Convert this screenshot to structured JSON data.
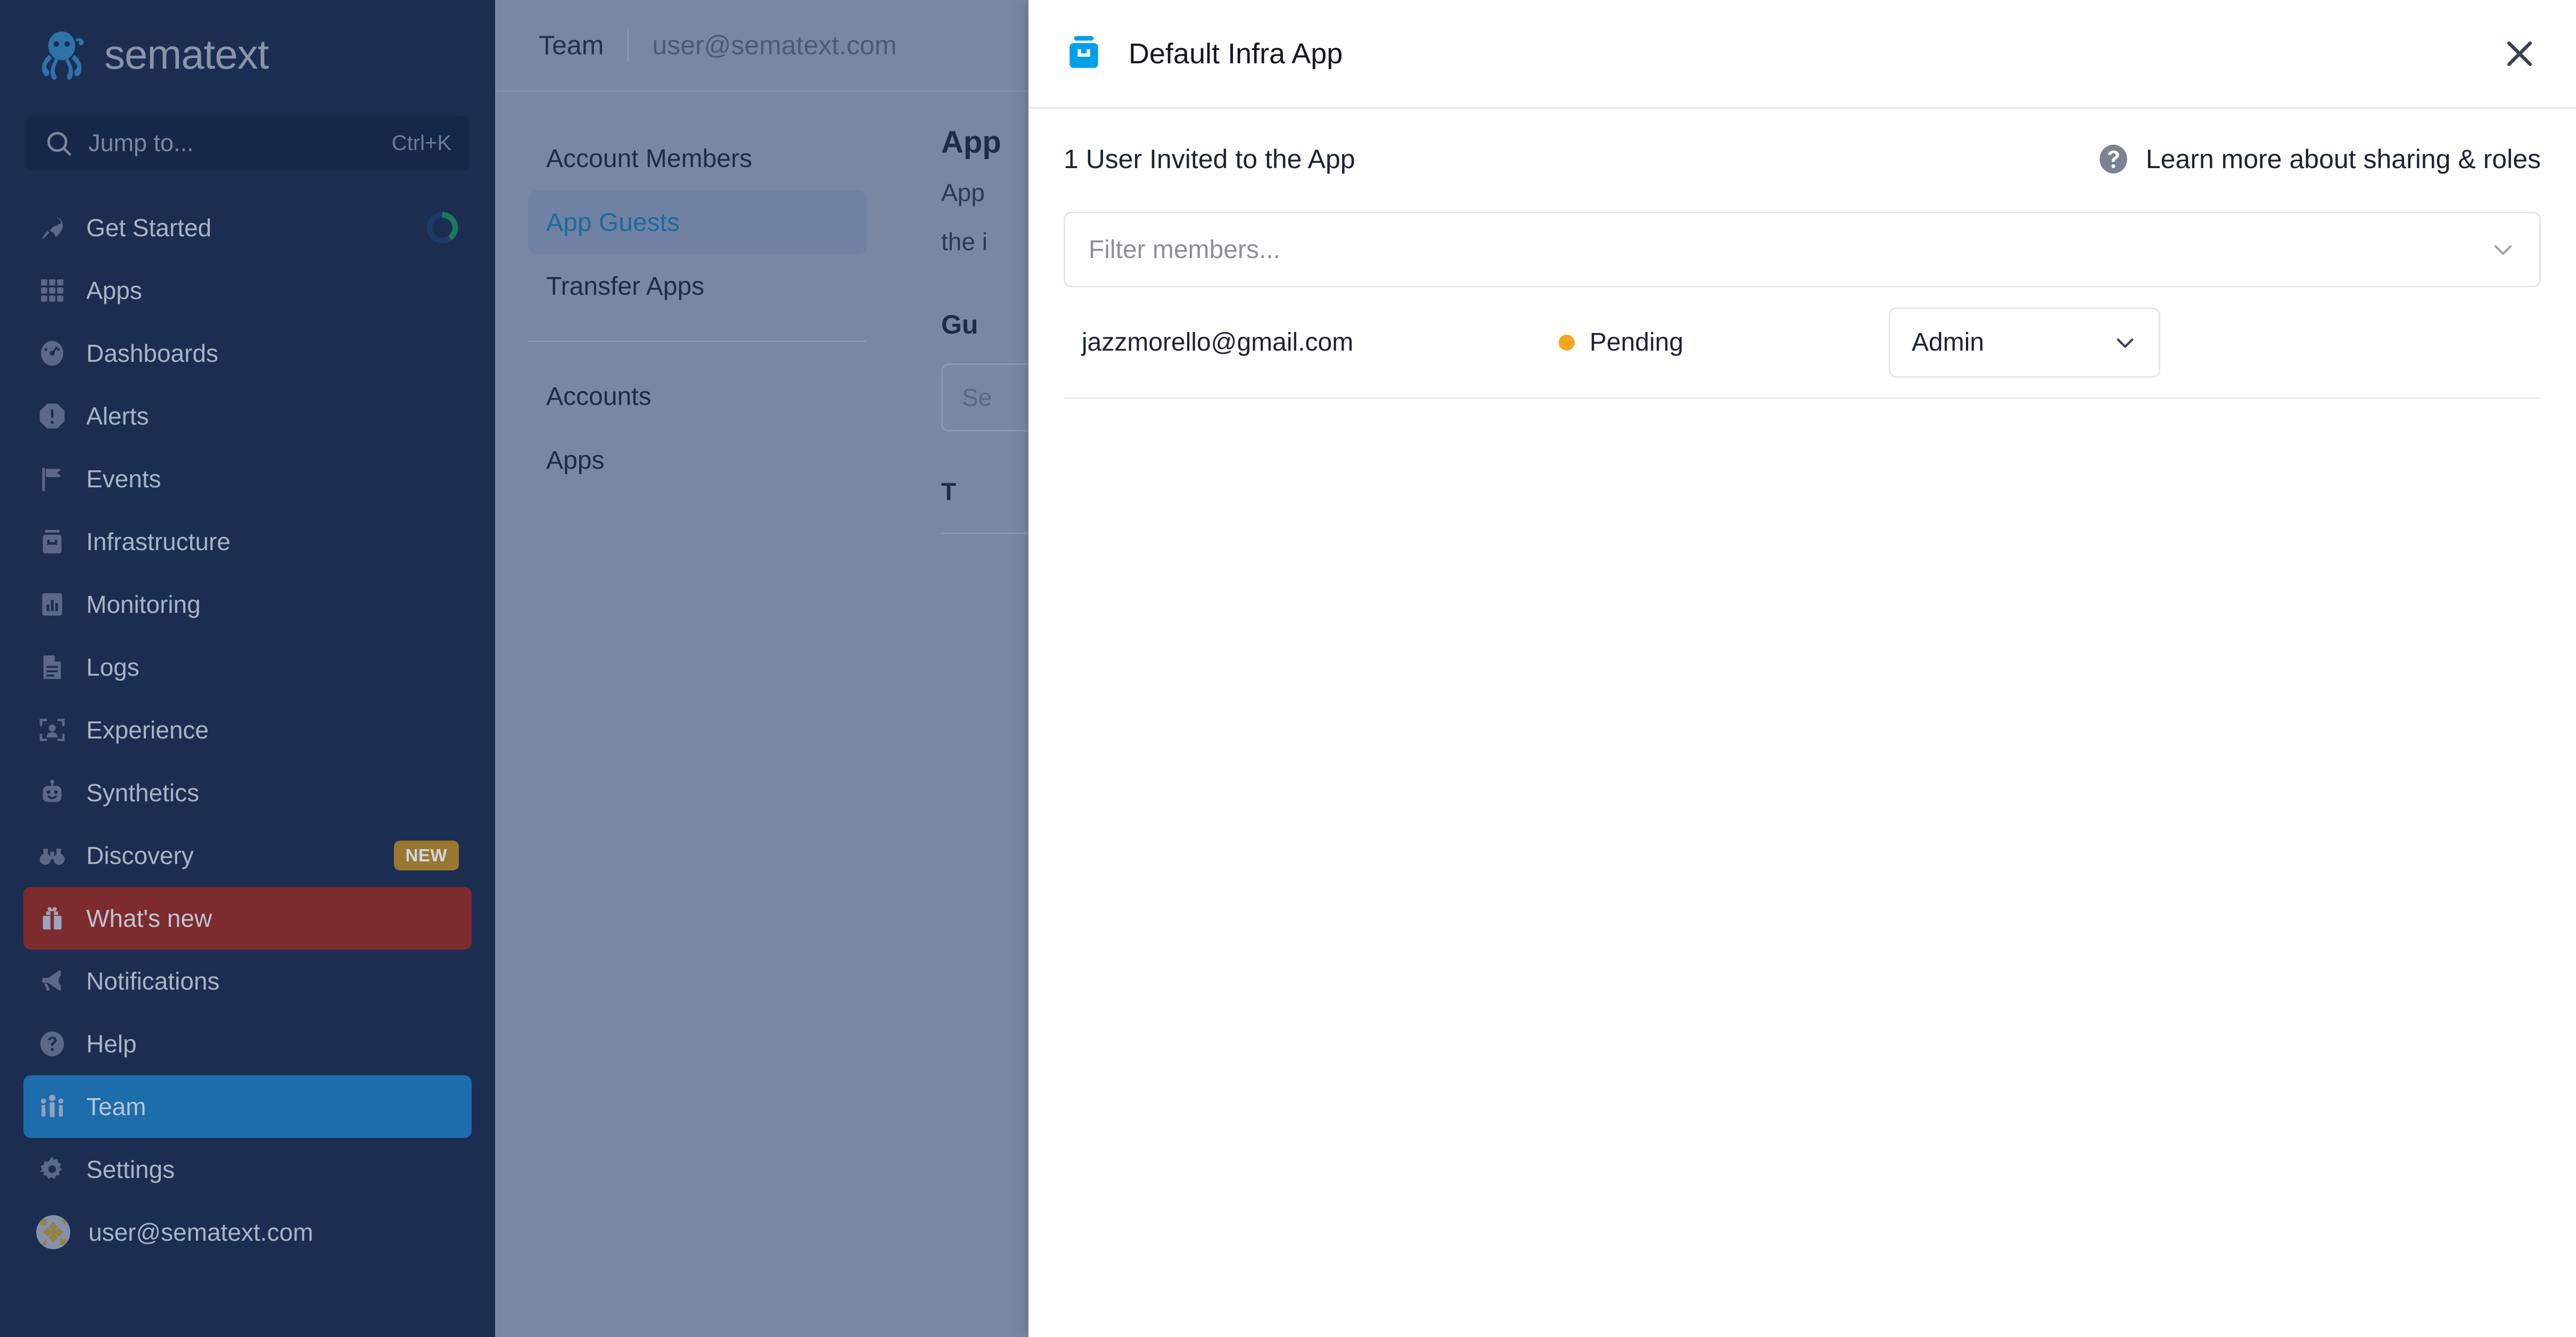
{
  "sidebar": {
    "brand": "sematext",
    "search": {
      "placeholder": "Jump to...",
      "shortcut": "Ctrl+K",
      "icon": "search-icon"
    },
    "items": [
      {
        "label": "Get Started",
        "icon": "rocket-icon",
        "state": "default",
        "ring": true
      },
      {
        "label": "Apps",
        "icon": "grid-icon",
        "state": "default"
      },
      {
        "label": "Dashboards",
        "icon": "gauge-icon",
        "state": "default"
      },
      {
        "label": "Alerts",
        "icon": "alert-octagon-icon",
        "state": "default"
      },
      {
        "label": "Events",
        "icon": "flag-icon",
        "state": "default"
      },
      {
        "label": "Infrastructure",
        "icon": "server-icon",
        "state": "default"
      },
      {
        "label": "Monitoring",
        "icon": "bar-chart-icon",
        "state": "default"
      },
      {
        "label": "Logs",
        "icon": "document-icon",
        "state": "default"
      },
      {
        "label": "Experience",
        "icon": "user-scan-icon",
        "state": "default"
      },
      {
        "label": "Synthetics",
        "icon": "robot-icon",
        "state": "default"
      },
      {
        "label": "Discovery",
        "icon": "binoculars-icon",
        "state": "default",
        "badge": "NEW"
      },
      {
        "label": "What's new",
        "icon": "gift-icon",
        "state": "active-red"
      },
      {
        "label": "Notifications",
        "icon": "megaphone-icon",
        "state": "default"
      },
      {
        "label": "Help",
        "icon": "question-circle-icon",
        "state": "default"
      },
      {
        "label": "Team",
        "icon": "team-icon",
        "state": "active-blue"
      },
      {
        "label": "Settings",
        "icon": "gear-icon",
        "state": "default"
      }
    ],
    "account": {
      "email": "user@sematext.com",
      "icon": "avatar"
    }
  },
  "page": {
    "breadcrumb": {
      "main": "Team",
      "sub": "user@sematext.com"
    },
    "subnav": {
      "group1": [
        "Account Members",
        "App Guests",
        "Transfer Apps"
      ],
      "group2": [
        "Accounts",
        "Apps"
      ],
      "active": "App Guests"
    },
    "main": {
      "title": "App",
      "desc_line1": "App",
      "desc_line2": "the i",
      "section": "Gu",
      "search_placeholder": "Se",
      "table_header": "T"
    }
  },
  "modal": {
    "title": "Default Infra App",
    "app_icon": "inbox-icon",
    "close_icon": "close-icon",
    "invited_count": "1 User Invited to the App",
    "learn_more": "Learn more about sharing & roles",
    "learn_more_icon": "question-circle-icon",
    "filter": {
      "placeholder": "Filter members...",
      "caret_icon": "chevron-down-icon"
    },
    "members": [
      {
        "email": "jazzmorello@gmail.com",
        "status": "Pending",
        "status_color": "#f5a623",
        "role": "Admin",
        "role_caret_icon": "chevron-down-icon"
      }
    ]
  },
  "colors": {
    "sidebar_bg": "#1b2e52",
    "sidebar_active_blue": "#1d6cab",
    "sidebar_active_red": "#7e2b2d",
    "badge_new": "#9a7631",
    "page_bg": "#7a87a2",
    "accent_blue": "#00a0e9",
    "pending_amber": "#f5a623",
    "progress_green": "#1c7a5c"
  }
}
